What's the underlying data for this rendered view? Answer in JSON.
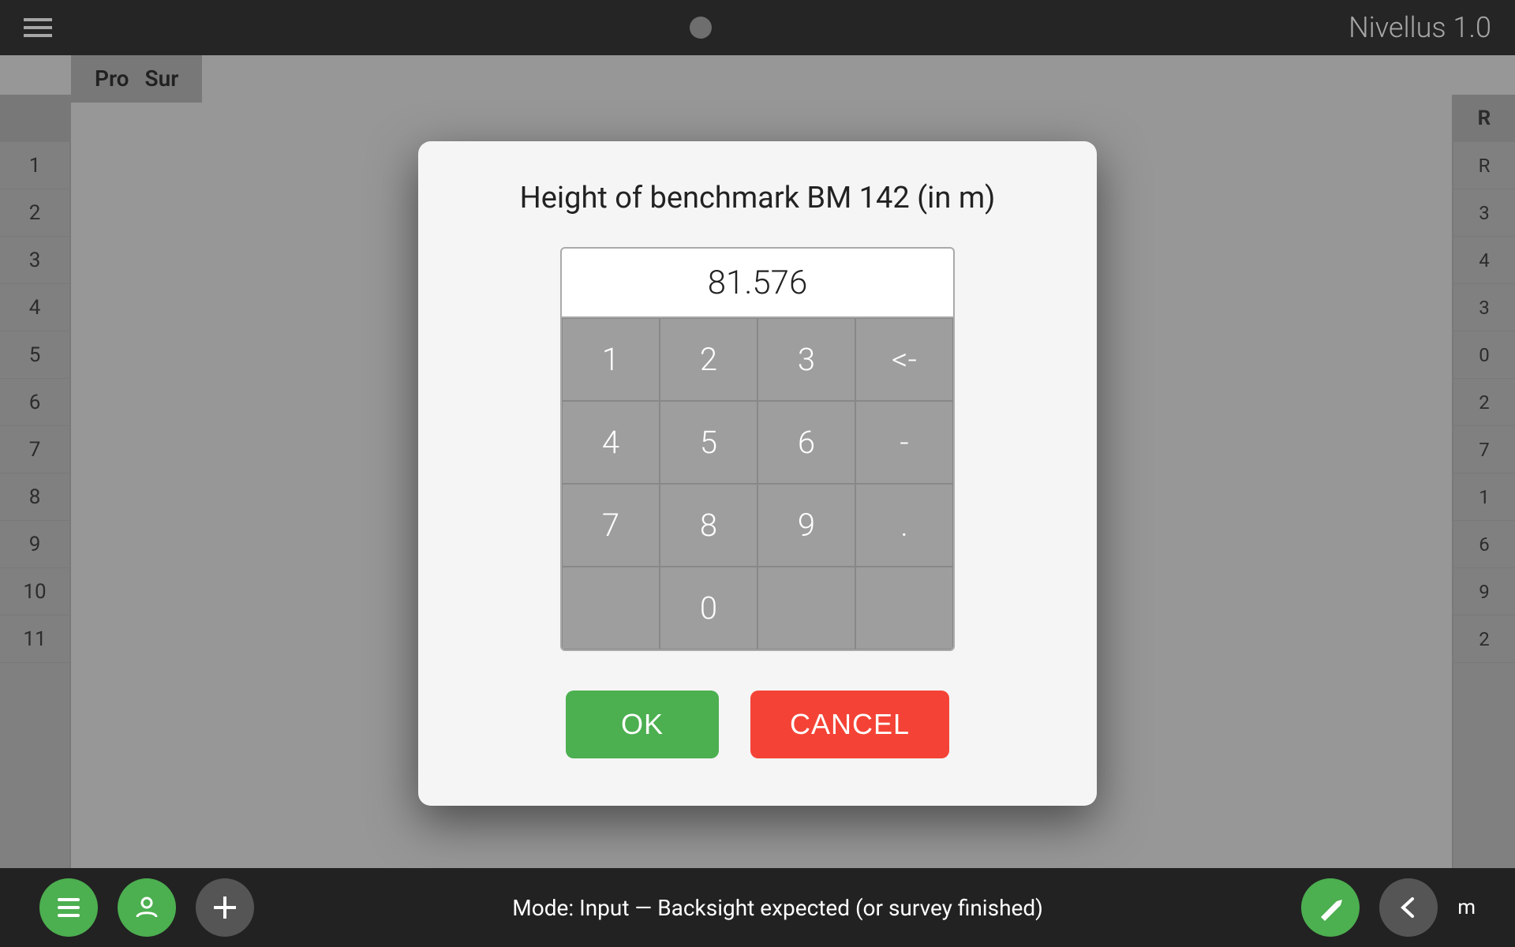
{
  "app": {
    "title": "Nivellus 1.0"
  },
  "dialog": {
    "title": "Height of benchmark BM 142 (in m)",
    "display_value": "81.576",
    "buttons": {
      "ok_label": "OK",
      "cancel_label": "CANCEL"
    },
    "numpad": {
      "keys": [
        {
          "label": "1",
          "type": "digit"
        },
        {
          "label": "2",
          "type": "digit"
        },
        {
          "label": "3",
          "type": "digit"
        },
        {
          "label": "<-",
          "type": "backspace"
        },
        {
          "label": "4",
          "type": "digit"
        },
        {
          "label": "5",
          "type": "digit"
        },
        {
          "label": "6",
          "type": "digit"
        },
        {
          "label": "-",
          "type": "minus"
        },
        {
          "label": "7",
          "type": "digit"
        },
        {
          "label": "8",
          "type": "digit"
        },
        {
          "label": "9",
          "type": "digit"
        },
        {
          "label": ".",
          "type": "decimal"
        },
        {
          "label": "",
          "type": "empty"
        },
        {
          "label": "0",
          "type": "digit"
        },
        {
          "label": "",
          "type": "empty"
        },
        {
          "label": "",
          "type": "empty"
        }
      ]
    }
  },
  "status_bar": {
    "text": "Mode: Input — Backsight expected (or survey finished)",
    "unit": "m"
  },
  "table": {
    "row_numbers": [
      "1",
      "2",
      "3",
      "4",
      "5",
      "6",
      "7",
      "8",
      "9",
      "10",
      "11"
    ]
  },
  "header": {
    "menu_label": "menu",
    "pro_label": "Pro",
    "sur_label": "Sur"
  }
}
